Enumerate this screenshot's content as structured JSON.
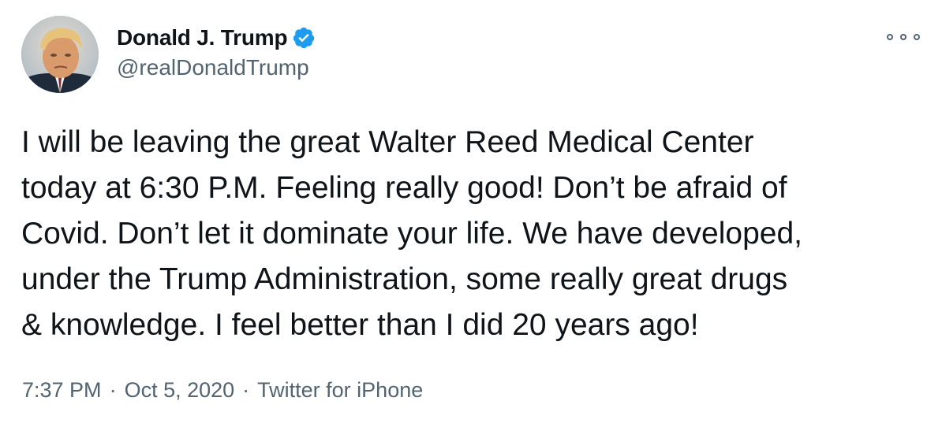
{
  "author": {
    "display_name": "Donald J. Trump",
    "handle": "@realDonaldTrump",
    "verified": true,
    "verified_color": "#1d9bf0"
  },
  "tweet": {
    "lines": [
      "I will be leaving the great Walter Reed Medical Center",
      "today at 6:30 P.M. Feeling really good! Don’t be afraid of",
      "Covid. Don’t let it dominate your life. We have developed,",
      "under the Trump Administration, some really great drugs",
      "& knowledge. I feel better than I did 20 years ago!"
    ]
  },
  "meta": {
    "time": "7:37 PM",
    "date": "Oct 5, 2020",
    "separator": "·",
    "source": "Twitter for iPhone"
  },
  "icons": {
    "more": "more-options-icon",
    "verified": "verified-badge-icon"
  }
}
